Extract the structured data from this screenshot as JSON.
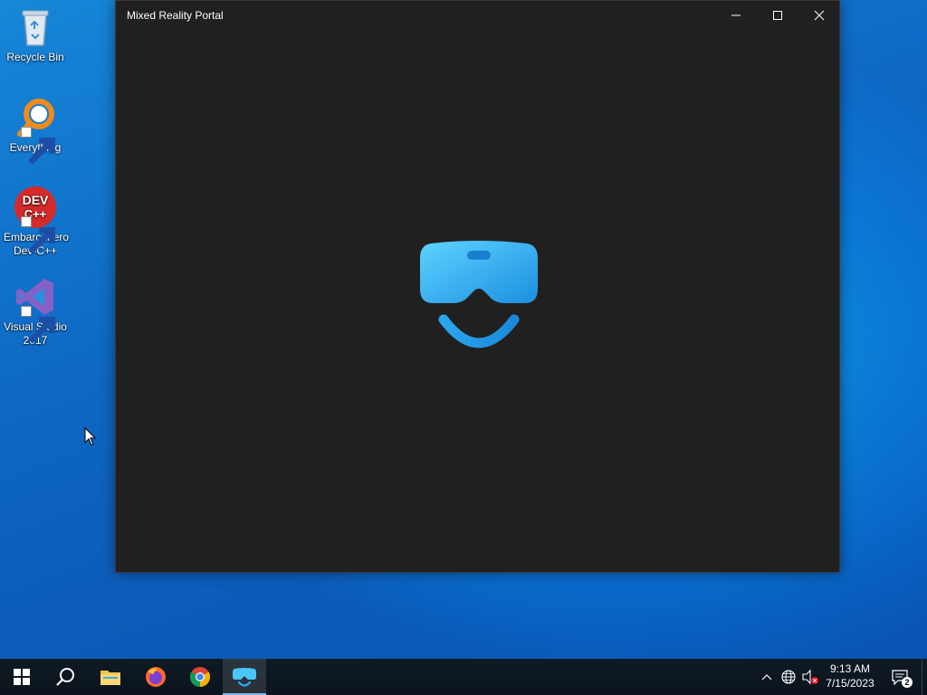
{
  "desktop": {
    "icons": [
      {
        "label": "Recycle Bin",
        "icon": "recycle-bin-icon"
      },
      {
        "label": "Everything",
        "icon": "everything-search-icon"
      },
      {
        "label": "Embarcadero Dev-C++",
        "icon": "devcpp-icon",
        "badge_text": "DEV C++"
      },
      {
        "label": "Visual Studio 2017",
        "icon": "visual-studio-icon"
      }
    ]
  },
  "window": {
    "title": "Mixed Reality Portal",
    "controls": {
      "minimize": "minimize-icon",
      "maximize": "maximize-icon",
      "close": "close-icon"
    },
    "accent": "#2ea7e8",
    "background": "#202020"
  },
  "taskbar": {
    "items": [
      {
        "name": "start",
        "icon": "windows-logo-icon"
      },
      {
        "name": "search",
        "icon": "search-icon"
      },
      {
        "name": "file-explorer",
        "icon": "folder-icon"
      },
      {
        "name": "firefox",
        "icon": "firefox-icon"
      },
      {
        "name": "chrome",
        "icon": "chrome-icon"
      },
      {
        "name": "mixed-reality-portal",
        "icon": "headset-icon",
        "active": true
      }
    ],
    "tray": {
      "chevron": "chevron-up-icon",
      "network": "network-globe-icon",
      "volume": "volume-muted-icon",
      "time": "9:13 AM",
      "date": "7/15/2023",
      "notification_count": "2"
    },
    "background": "#0e1a24"
  }
}
